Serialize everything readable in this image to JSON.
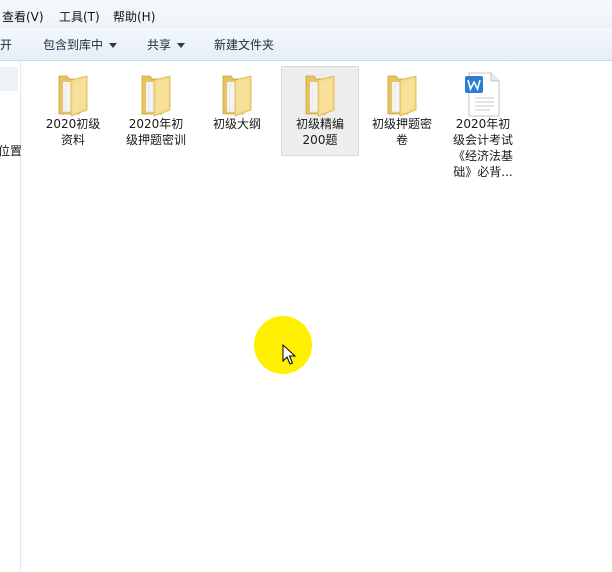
{
  "menubar": {
    "items": [
      "查看(V)",
      "工具(T)",
      "帮助(H)"
    ]
  },
  "toolbar": {
    "open_label": "开",
    "include_library_label": "包含到库中",
    "share_label": "共享",
    "new_folder_label": "新建文件夹"
  },
  "nav": {
    "partial_label": "位置"
  },
  "files": [
    {
      "name": "2020初级资料",
      "label_lines": [
        "2020初级",
        "资料"
      ],
      "icon": "folder-icon",
      "selected": false
    },
    {
      "name": "2020年初级押题密训",
      "label_lines": [
        "2020年初",
        "级押题密训"
      ],
      "icon": "folder-icon",
      "selected": false
    },
    {
      "name": "初级大纲",
      "label_lines": [
        "初级大纲"
      ],
      "icon": "folder-icon",
      "selected": false
    },
    {
      "name": "初级精编200题",
      "label_lines": [
        "初级精编",
        "200题"
      ],
      "icon": "folder-icon",
      "selected": true
    },
    {
      "name": "初级押题密卷",
      "label_lines": [
        "初级押题密",
        "卷"
      ],
      "icon": "folder-icon",
      "selected": false
    },
    {
      "name": "2020年初级会计考试《经济法基础》必背...",
      "label_lines": [
        "2020年初",
        "级会计考试",
        "《经济法基",
        "础》必背..."
      ],
      "icon": "word-document-icon",
      "selected": false
    }
  ],
  "colors": {
    "cursor_highlight": "#ffef00",
    "selection": "#eeeeee",
    "toolbar": "#e5edf7",
    "word_blue": "#2b7cd3",
    "folder_yellow": "#f3d27a"
  }
}
